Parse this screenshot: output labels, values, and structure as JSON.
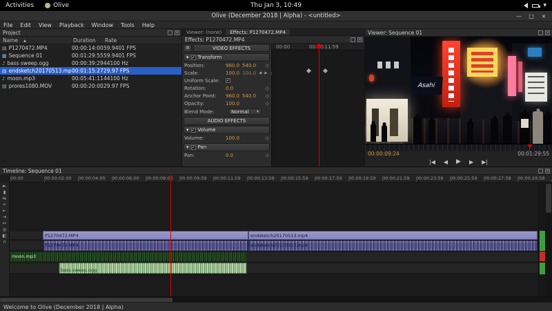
{
  "topbar": {
    "activities": "Activities",
    "app_name": "Olive",
    "clock": "Thu Jan 3, 10:49"
  },
  "window": {
    "title": "Olive (December 2018 | Alpha) - <untitled>"
  },
  "menu": {
    "items": [
      "File",
      "Edit",
      "View",
      "Playback",
      "Window",
      "Tools",
      "Help"
    ]
  },
  "project": {
    "title": "Project",
    "columns": [
      "Name",
      "Duration",
      "Rate"
    ],
    "rows": [
      {
        "name": "P1270472.MP4",
        "duration": "00:00:14:00",
        "rate": "59.9401 FPS"
      },
      {
        "name": "Sequence 01",
        "duration": "00:01:29:55",
        "rate": "59.9401 FPS"
      },
      {
        "name": "bass sweep.ogg",
        "duration": "00:00:39:29",
        "rate": "44100 Hz"
      },
      {
        "name": "endsketch20170513.mp4",
        "duration": "00:01:15:27",
        "rate": "29.97 FPS"
      },
      {
        "name": "moon.mp3",
        "duration": "00:05:41:11",
        "rate": "44100 Hz"
      },
      {
        "name": "prores1080.MOV",
        "duration": "00:00:20:00",
        "rate": "29.97 FPS"
      }
    ]
  },
  "effects": {
    "tab_viewer": "Viewer: (none)",
    "tab_effects": "Effects: P1270472.MP4",
    "title": "Effects: P1270472.MP4",
    "video_header": "VIDEO EFFECTS",
    "audio_header": "AUDIO EFFECTS",
    "transform_title": "Transform",
    "rows": {
      "position": {
        "label": "Position:",
        "x": "960.0",
        "y": "540.0"
      },
      "scale": {
        "label": "Scale:",
        "x": "100.0",
        "y": "100.0"
      },
      "uniform": {
        "label": "Uniform Scale:"
      },
      "rotation": {
        "label": "Rotation:",
        "value": "0.0"
      },
      "anchor": {
        "label": "Anchor Point:",
        "x": "960.0",
        "y": "540.0"
      },
      "opacity": {
        "label": "Opacity:",
        "value": "100.0"
      },
      "blend": {
        "label": "Blend Mode:",
        "value": "Normal"
      }
    },
    "volume_title": "Volume",
    "volume_row": {
      "label": "Volume:",
      "value": "100.0"
    },
    "pan_title": "Pan",
    "pan_row": {
      "label": "Pan:",
      "value": "0.0"
    },
    "ruler_start": "00:00",
    "ruler_end": "00:00:11:59"
  },
  "viewer": {
    "title": "Viewer: Sequence 01",
    "current_time": "00:00:09:24",
    "duration": "00:01:29:55",
    "sign_text": "Asahi"
  },
  "timeline": {
    "title": "Timeline: Sequence 01",
    "ruler": [
      "00:00",
      "00:00:02:00",
      "00:00:04:00",
      "00:00:06:00",
      "00:00:08:00",
      "00:00:09:59",
      "00:00:11:59",
      "00:00:13:59",
      "00:00:15:59",
      "00:00:17:59",
      "00:00:19:59",
      "00:00:21:59",
      "00:00:23:59",
      "00:00:25:59",
      "00:00:27:58",
      "00:00:29:58"
    ],
    "tools": [
      {
        "name": "pointer",
        "glyph": "►"
      },
      {
        "name": "edit",
        "glyph": "▮"
      },
      {
        "name": "ripple",
        "glyph": "⇆"
      },
      {
        "name": "razor",
        "glyph": "✂"
      },
      {
        "name": "slip",
        "glyph": "⇤"
      },
      {
        "name": "slide",
        "glyph": "⇥"
      },
      {
        "name": "hand",
        "glyph": "↔"
      },
      {
        "name": "zoom",
        "glyph": "◎"
      },
      {
        "name": "transition",
        "glyph": "◧"
      },
      {
        "name": "snap",
        "glyph": "∩"
      }
    ],
    "tracks": {
      "video1": [
        {
          "label": "P1270472.MP4"
        },
        {
          "label": "endsketch20170513.mp4"
        }
      ],
      "audio1": [
        {
          "label": "P1270472.MP4"
        },
        {
          "label": "endsketch20170513.mp4"
        }
      ],
      "audio2": [
        {
          "label": "moon.mp3"
        }
      ],
      "audio3": [
        {
          "label": "bass sweep.ogg"
        }
      ]
    }
  },
  "statusbar": {
    "message": "Welcome to Olive (December 2018 | Alpha)"
  },
  "icons": {
    "caret": "▾",
    "minimize": "—",
    "maximize": "□",
    "close": "×",
    "panel_close": "×",
    "sort_asc": "▴",
    "project_video": "▤",
    "project_sequence": "▦",
    "project_audio": "♪",
    "menu_grid": "≡",
    "collapse": "▾",
    "check": "✓",
    "keyframe": "◇",
    "spin_left": "◀",
    "spin_right": "▶",
    "dropdown_caret": "▾",
    "transport_start": "|◀",
    "transport_prev": "◀",
    "transport_play": "▶",
    "transport_next": "▶",
    "transport_end": "▶|"
  },
  "colors": {
    "selection": "#2b5ec6",
    "playhead": "#dd0000",
    "value_text": "#d09a3e",
    "video_clip": "#8f8dc5",
    "audio_clip_dark_green": "#6fa26f",
    "audio_clip_light_green": "#b8d8ac"
  }
}
